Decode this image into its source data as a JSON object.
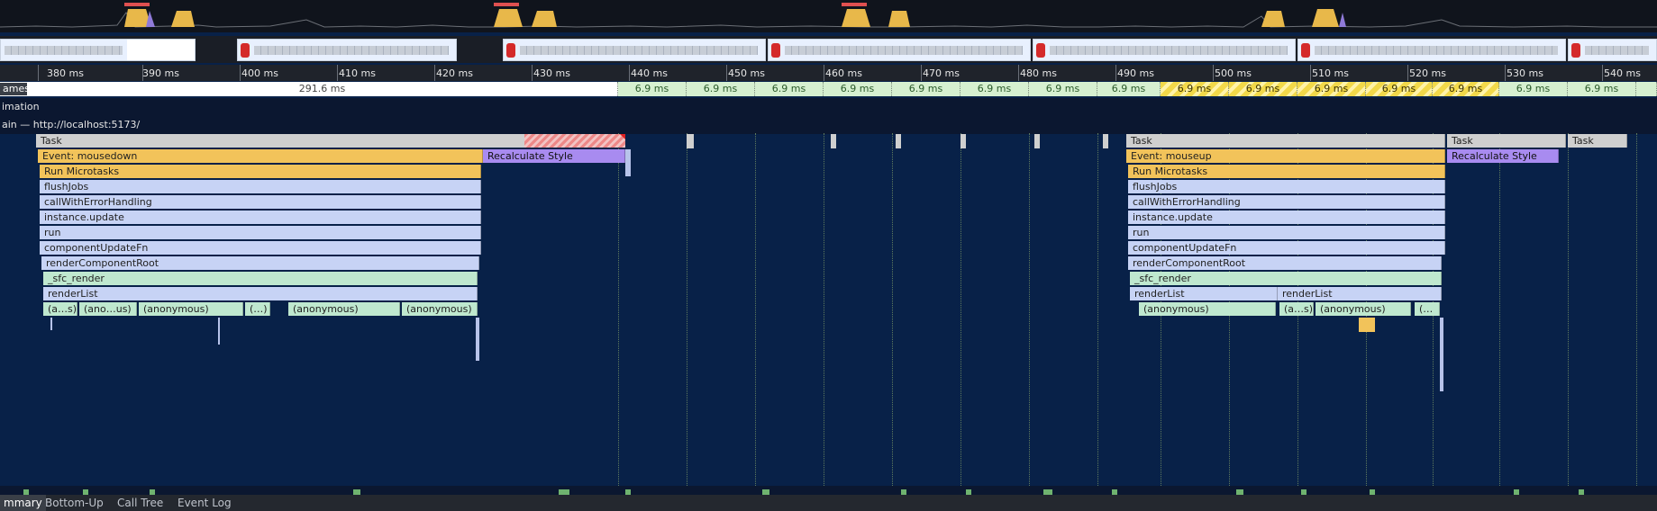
{
  "ruler": {
    "labels": [
      "380 ms",
      "390 ms",
      "400 ms",
      "410 ms",
      "420 ms",
      "430 ms",
      "440 ms",
      "450 ms",
      "460 ms",
      "470 ms",
      "480 ms",
      "490 ms",
      "500 ms",
      "510 ms",
      "520 ms",
      "530 ms",
      "540 ms"
    ]
  },
  "frames": {
    "track_label": "ames",
    "long_frame": "291.6 ms",
    "short_frame": "6.9 ms"
  },
  "tracks": {
    "animation": "imation",
    "main": "ain — http://localhost:5173/"
  },
  "flame_left": {
    "task": "Task",
    "event": "Event: mousedown",
    "micro": "Run Microtasks",
    "flush": "flushJobs",
    "call": "callWithErrorHandling",
    "update": "instance.update",
    "run": "run",
    "cuf": "componentUpdateFn",
    "rcr": "renderComponentRoot",
    "sfc": "_sfc_render",
    "rl": "renderList",
    "a1": "(a…s)",
    "a2": "(ano…us)",
    "a3": "(anonymous)",
    "a4": "(…)",
    "a5": "(anonymous)",
    "a6": "(anonymous)",
    "style": "Recalculate Style"
  },
  "flame_right": {
    "task1": "Task",
    "task2": "Task",
    "task3": "Task",
    "event": "Event: mouseup",
    "micro": "Run Microtasks",
    "flush": "flushJobs",
    "call": "callWithErrorHandling",
    "update": "instance.update",
    "run": "run",
    "cuf": "componentUpdateFn",
    "rcr": "renderComponentRoot",
    "sfc": "_sfc_render",
    "rl1": "renderList",
    "rl2": "renderList",
    "a1": "(anonymous)",
    "a2": "(a…s)",
    "a3": "(anonymous)",
    "a4": "(…",
    "style": "Recalculate Style"
  },
  "tabs": {
    "summary": "mmary",
    "bottom_up": "Bottom-Up",
    "call_tree": "Call Tree",
    "event_log": "Event Log"
  },
  "colors": {
    "background": "#082148",
    "task": "#cfcfcf",
    "event": "#f2c35a",
    "function": "#c7d3f5",
    "render": "#bfe8cf",
    "style": "#a88bf0",
    "frame_green": "#d6f0d0",
    "frame_yellow": "#f2d94a"
  }
}
